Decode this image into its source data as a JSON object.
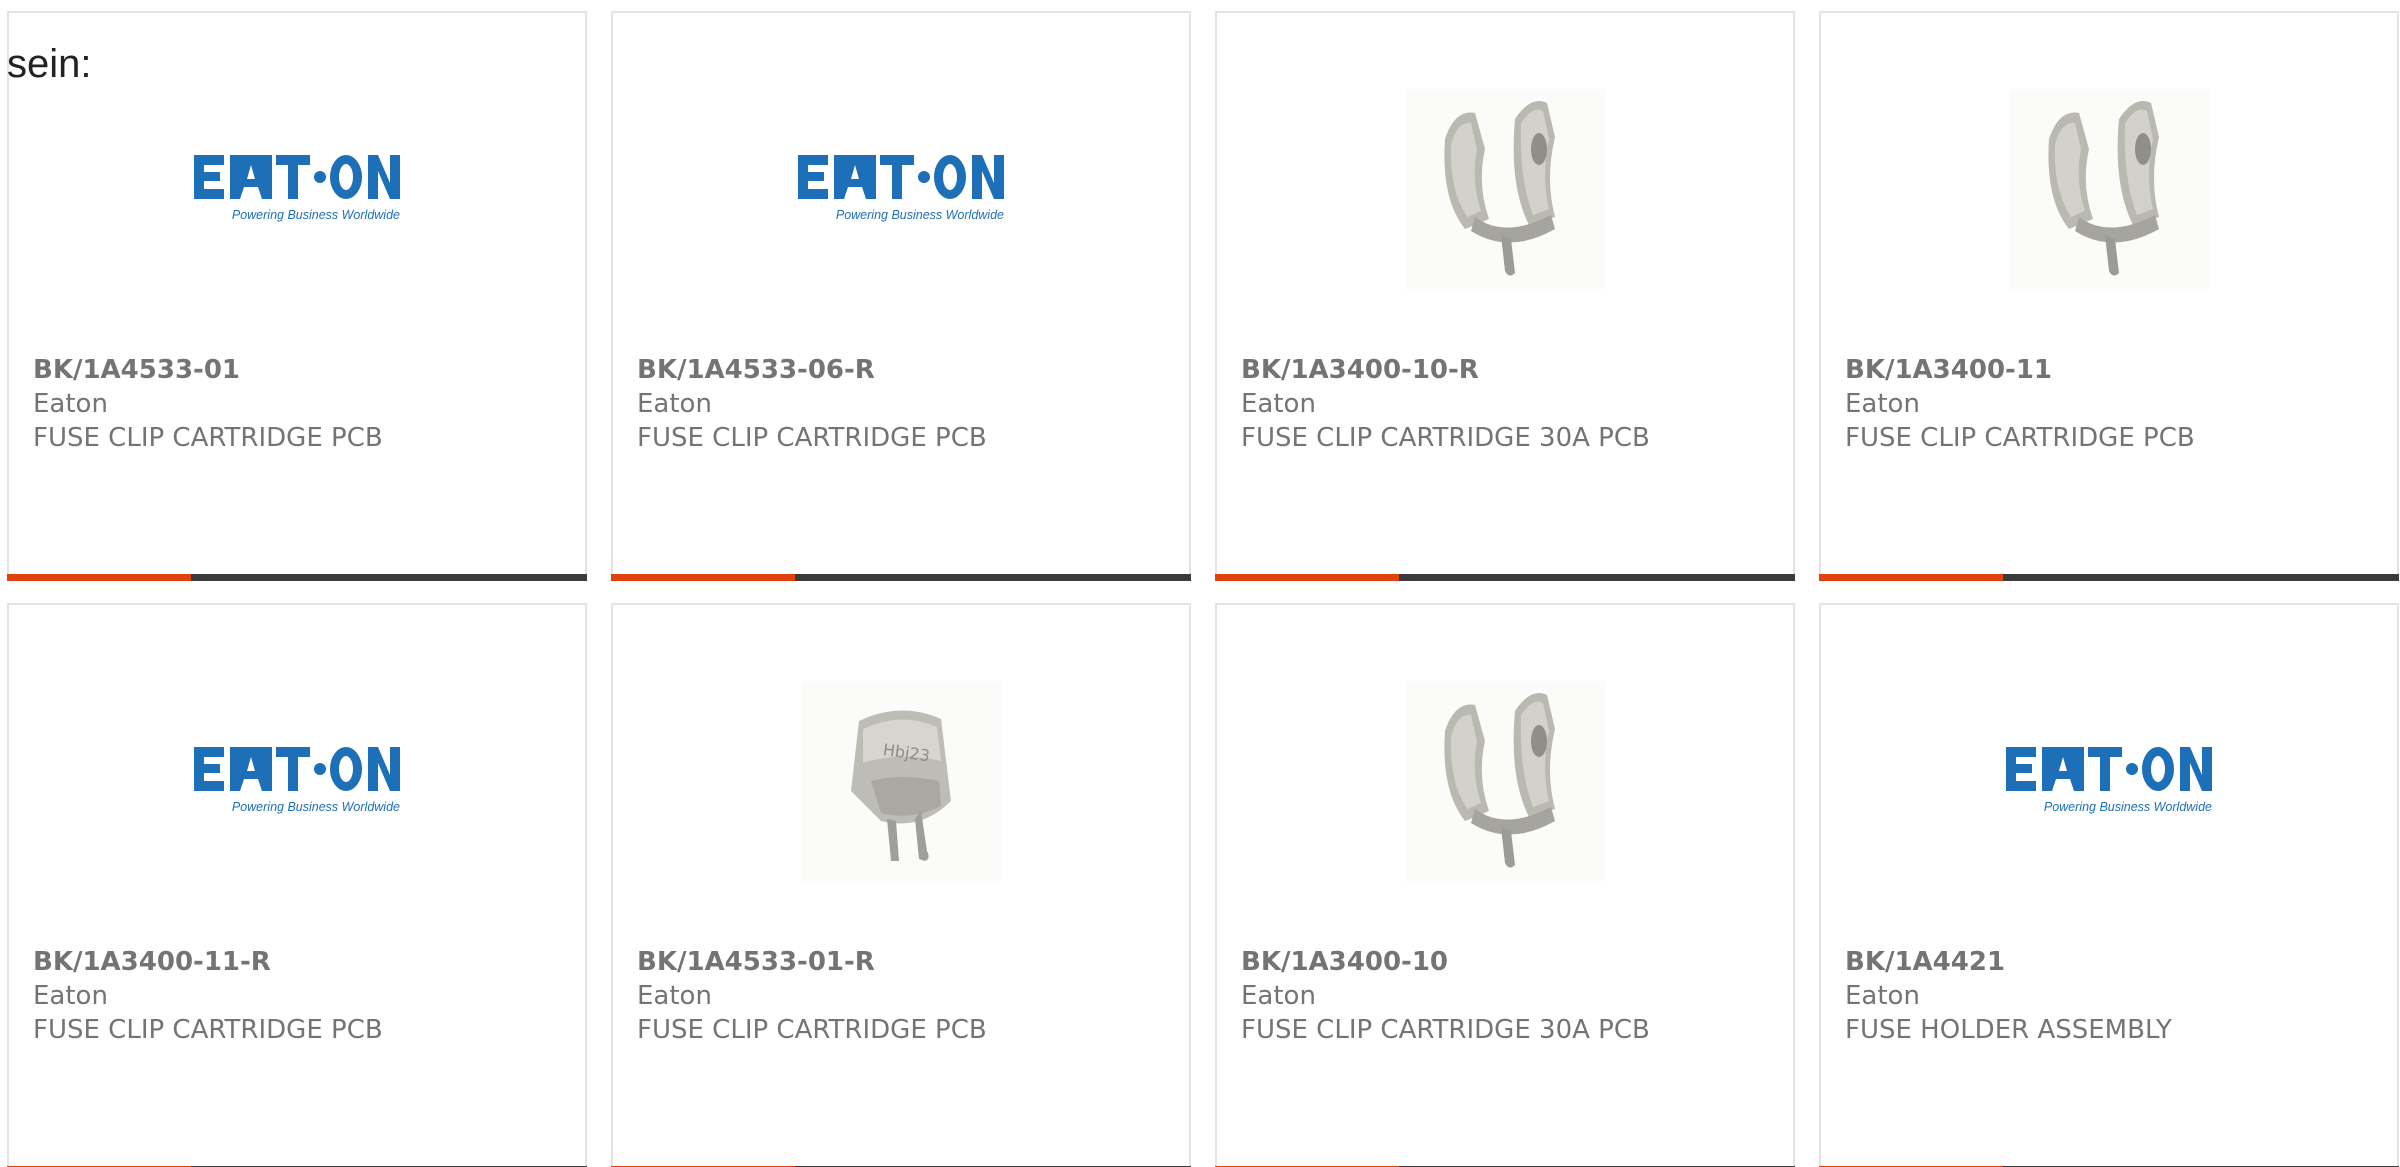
{
  "intro_text": "sein:",
  "colors": {
    "accent": "#e0430f",
    "bar": "#3b3b3b",
    "eaton_blue": "#1d6fb8",
    "text": "#747474"
  },
  "logo": {
    "word": "EATON",
    "tagline": "Powering Business Worldwide"
  },
  "products": [
    {
      "part_number": "BK/1A4533-01",
      "manufacturer": "Eaton",
      "description": "FUSE CLIP CARTRIDGE PCB",
      "image": "eaton-logo"
    },
    {
      "part_number": "BK/1A4533-06-R",
      "manufacturer": "Eaton",
      "description": "FUSE CLIP CARTRIDGE PCB",
      "image": "eaton-logo"
    },
    {
      "part_number": "BK/1A3400-10-R",
      "manufacturer": "Eaton",
      "description": "FUSE CLIP CARTRIDGE 30A PCB",
      "image": "fuse-clip-photo"
    },
    {
      "part_number": "BK/1A3400-11",
      "manufacturer": "Eaton",
      "description": "FUSE CLIP CARTRIDGE PCB",
      "image": "fuse-clip-photo"
    },
    {
      "part_number": "BK/1A3400-11-R",
      "manufacturer": "Eaton",
      "description": "FUSE CLIP CARTRIDGE PCB",
      "image": "eaton-logo"
    },
    {
      "part_number": "BK/1A4533-01-R",
      "manufacturer": "Eaton",
      "description": "FUSE CLIP CARTRIDGE PCB",
      "image": "fuse-clip-photo-alt"
    },
    {
      "part_number": "BK/1A3400-10",
      "manufacturer": "Eaton",
      "description": "FUSE CLIP CARTRIDGE 30A PCB",
      "image": "fuse-clip-photo"
    },
    {
      "part_number": "BK/1A4421",
      "manufacturer": "Eaton",
      "description": "FUSE HOLDER ASSEMBLY",
      "image": "eaton-logo"
    }
  ]
}
